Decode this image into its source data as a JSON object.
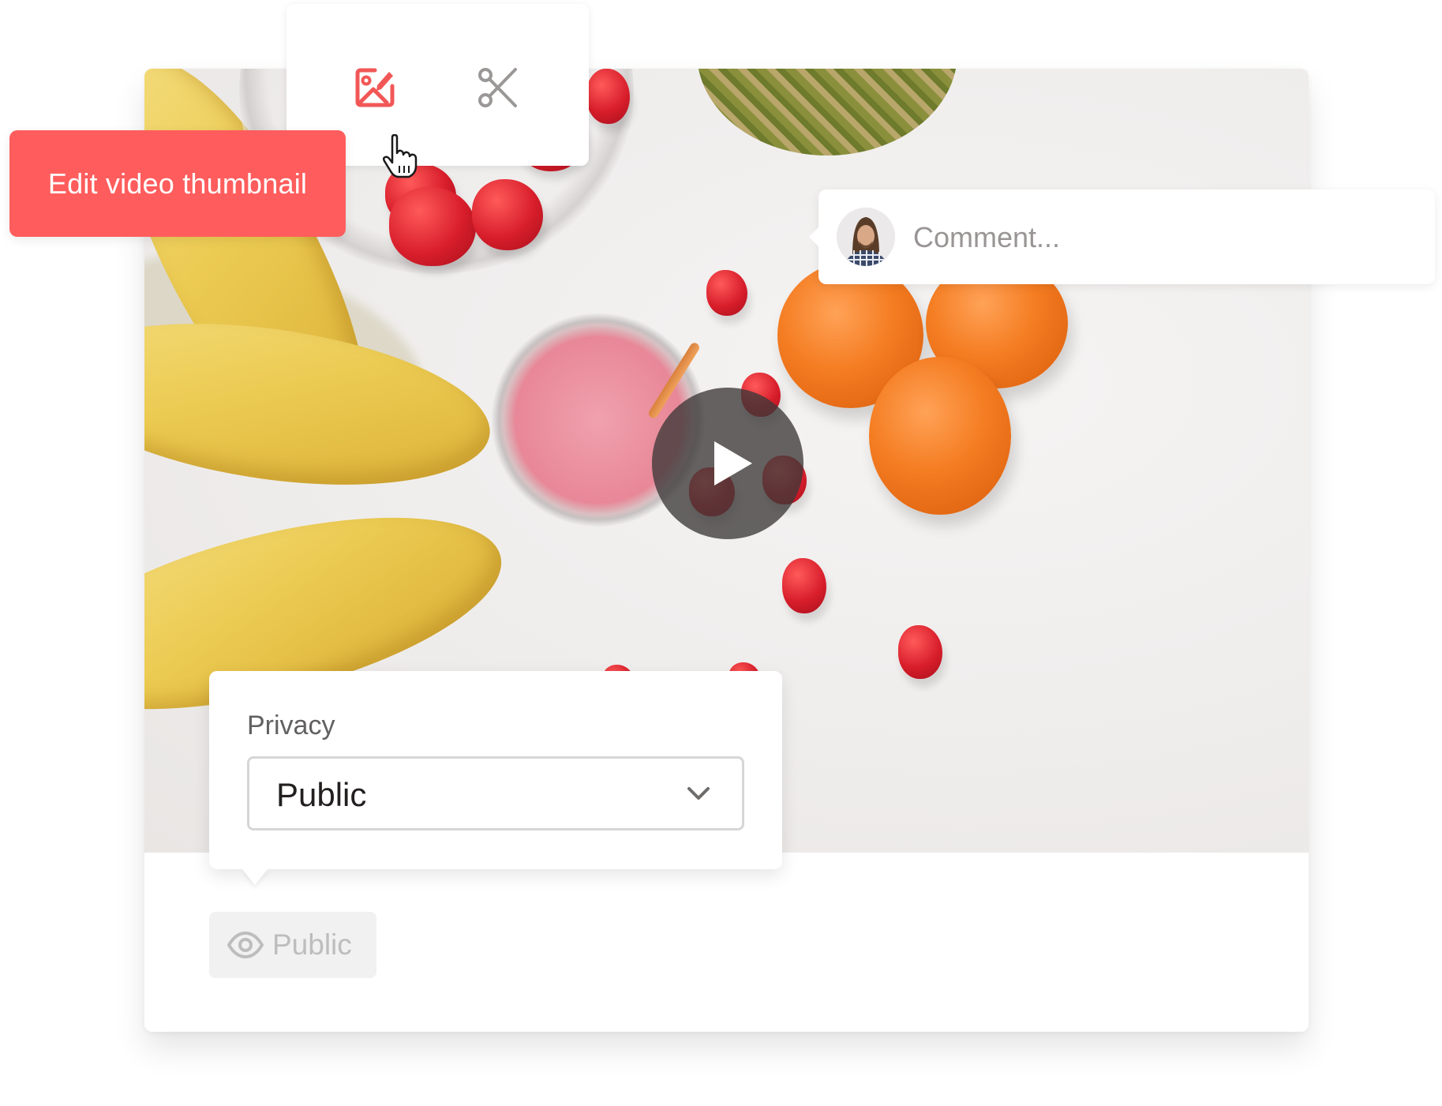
{
  "toolbar": {
    "items": [
      {
        "icon": "image-edit-icon",
        "label": "Edit thumbnail",
        "active": true
      },
      {
        "icon": "scissors-icon",
        "label": "Trim",
        "active": false
      }
    ]
  },
  "tooltip": {
    "text": "Edit video thumbnail"
  },
  "comment": {
    "placeholder": "Comment...",
    "value": "",
    "avatar": "user-avatar"
  },
  "privacy": {
    "label": "Privacy",
    "selected": "Public"
  },
  "visibility_badge": {
    "icon": "eye-icon",
    "label": "Public"
  },
  "video": {
    "play_icon": "play-icon",
    "thumbnail": "fruit-smoothie-photo"
  },
  "colors": {
    "accent": "#ff5d5d",
    "icon_gray": "#9b9797",
    "badge_bg": "#f1f1f1"
  }
}
